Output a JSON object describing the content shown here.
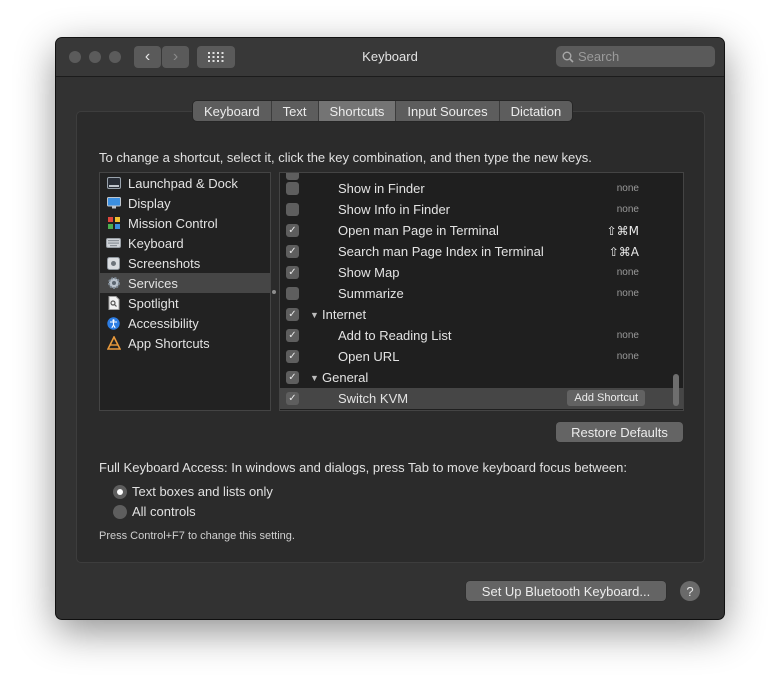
{
  "window": {
    "title": "Keyboard"
  },
  "toolbar": {
    "back_glyph": "‹",
    "forward_glyph": "›",
    "search_placeholder": "Search"
  },
  "tabs": [
    {
      "label": "Keyboard",
      "active": false
    },
    {
      "label": "Text",
      "active": false
    },
    {
      "label": "Shortcuts",
      "active": true
    },
    {
      "label": "Input Sources",
      "active": false
    },
    {
      "label": "Dictation",
      "active": false
    }
  ],
  "instruction": "To change a shortcut, select it, click the key combination, and then type the new keys.",
  "categories": [
    {
      "label": "Launchpad & Dock",
      "icon": "launchpad-icon"
    },
    {
      "label": "Display",
      "icon": "display-icon"
    },
    {
      "label": "Mission Control",
      "icon": "mission-control-icon"
    },
    {
      "label": "Keyboard",
      "icon": "keyboard-icon"
    },
    {
      "label": "Screenshots",
      "icon": "screenshots-icon"
    },
    {
      "label": "Services",
      "icon": "gear-icon",
      "selected": true
    },
    {
      "label": "Spotlight",
      "icon": "spotlight-icon"
    },
    {
      "label": "Accessibility",
      "icon": "accessibility-icon"
    },
    {
      "label": "App Shortcuts",
      "icon": "app-shortcuts-icon"
    }
  ],
  "shortcuts": [
    {
      "label": "Show in Finder",
      "checked": false,
      "key": "none"
    },
    {
      "label": "Show Info in Finder",
      "checked": false,
      "key": "none"
    },
    {
      "label": "Open man Page in Terminal",
      "checked": true,
      "key": "⇧⌘M"
    },
    {
      "label": "Search man Page Index in Terminal",
      "checked": true,
      "key": "⇧⌘A"
    },
    {
      "label": "Show Map",
      "checked": true,
      "key": "none"
    },
    {
      "label": "Summarize",
      "checked": false,
      "key": "none"
    },
    {
      "label": "Internet",
      "checked": true,
      "group": true
    },
    {
      "label": "Add to Reading List",
      "checked": true,
      "key": "none"
    },
    {
      "label": "Open URL",
      "checked": true,
      "key": "none"
    },
    {
      "label": "General",
      "checked": true,
      "group": true
    },
    {
      "label": "Switch KVM",
      "checked": true,
      "selected": true,
      "add_label": "Add Shortcut"
    }
  ],
  "buttons": {
    "restore_defaults": "Restore Defaults",
    "bluetooth": "Set Up Bluetooth Keyboard...",
    "help": "?"
  },
  "full_keyboard_access": {
    "label": "Full Keyboard Access: In windows and dialogs, press Tab to move keyboard focus between:",
    "options": [
      {
        "label": "Text boxes and lists only",
        "selected": true
      },
      {
        "label": "All controls",
        "selected": false
      }
    ],
    "hint": "Press Control+F7 to change this setting."
  },
  "colors": {
    "window_bg": "#323232",
    "selected_row": "#464646",
    "accent_blue": "#2d7de3"
  }
}
